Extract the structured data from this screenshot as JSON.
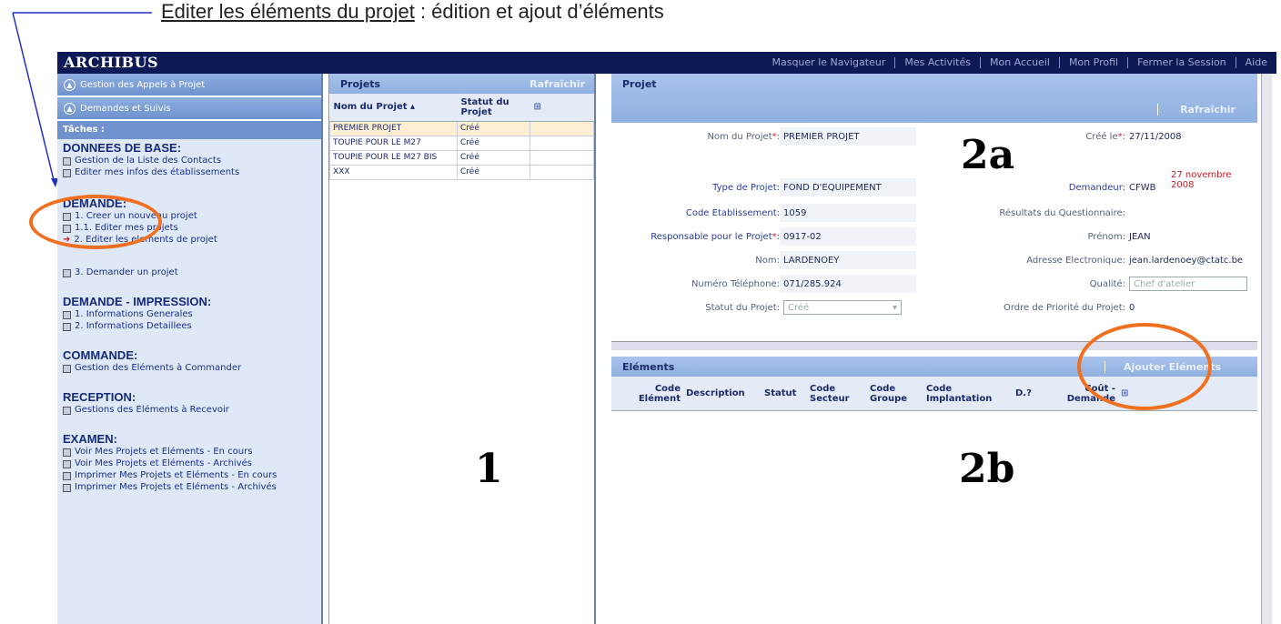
{
  "caption": {
    "link": "Editer les éléments du projet",
    "rest": " : édition et ajout d’éléments"
  },
  "app": {
    "logo": "ARCHIBUS"
  },
  "topnav": [
    "Masquer le Navigateur",
    "Mes Activités",
    "Mon Accueil",
    "Mon Profil",
    "Fermer la Session",
    "Aide"
  ],
  "nav": {
    "acc1": "Gestion des Appels à Projet",
    "acc2": "Demandes et Suivis",
    "taches": "Tâches :",
    "sections": [
      {
        "title": "DONNEES DE BASE:",
        "items": [
          "Gestion de la Liste des Contacts",
          "Editer mes infos des établissements"
        ]
      },
      {
        "title": "DEMANDE:",
        "items": [
          "1. Creer un nouveau projet",
          "1.1. Editer mes projets",
          "2. Editer les elements de projet",
          "3. Demander un projet"
        ]
      },
      {
        "title": "DEMANDE - IMPRESSION:",
        "items": [
          "1. Informations Generales",
          "2. Informations Detaillees"
        ]
      },
      {
        "title": "COMMANDE:",
        "items": [
          "Gestion des Eléments à Commander"
        ]
      },
      {
        "title": "RECEPTION:",
        "items": [
          "Gestions des Eléments à Recevoir"
        ]
      },
      {
        "title": "EXAMEN:",
        "items": [
          "Voir Mes Projets et Eléments - En cours",
          "Voir Mes Projets et Eléments - Archivés",
          "Imprimer Mes Projets et Eléments - En cours",
          "Imprimer Mes Projets et Eléments - Archivés"
        ]
      }
    ]
  },
  "projets": {
    "title": "Projets",
    "refresh": "Rafraîchir",
    "col1": "Nom du Projet",
    "col2": "Statut du Projet",
    "rows": [
      {
        "name": "PREMIER PROJET",
        "status": "Créé"
      },
      {
        "name": "TOUPIE POUR LE M27",
        "status": "Créé"
      },
      {
        "name": "TOUPIE POUR LE M27 BIS",
        "status": "Créé"
      },
      {
        "name": "XXX",
        "status": "Créé"
      }
    ]
  },
  "projet": {
    "title": "Projet",
    "refresh": "Rafraîchir",
    "fields": {
      "nom_label": "Nom du Projet",
      "nom": "PREMIER PROJET",
      "cree_label": "Créé le",
      "cree": "27/11/2008",
      "cree_long": "27 novembre 2008",
      "type_label": "Type de Projet:",
      "type": "FOND D'EQUIPEMENT",
      "demandeur_label": "Demandeur:",
      "demandeur": "CFWB",
      "code_label": "Code Etablissement:",
      "code": "1059",
      "resultats_label": "Résultats du Questionnaire:",
      "resp_label": "Responsable pour le Projet",
      "resp": "0917-02",
      "prenom_label": "Prénom:",
      "prenom": "JEAN",
      "nomp_label": "Nom:",
      "nomp": "LARDENOEY",
      "email_label": "Adresse Electronique:",
      "email": "jean.lardenoey@ctatc.be",
      "tel_label": "Numéro Téléphone:",
      "tel": "071/285.924",
      "qualite_label": "Qualité:",
      "qualite": "Chef d'atelier",
      "statut_label": "Statut du Projet:",
      "statut": "Créé",
      "ordre_label": "Ordre de Priorité du Projet:",
      "ordre": "0"
    }
  },
  "elements": {
    "title": "Eléments",
    "add": "Ajouter Eléments",
    "cols": [
      "Code Elément",
      "Description",
      "Statut",
      "Code Secteur",
      "Code Groupe",
      "Code Implantation",
      "D.?",
      "Coût - Demande"
    ]
  },
  "markers": {
    "one": "1",
    "two_a": "2a",
    "two_b": "2b"
  },
  "colors": {
    "topbar": "#0d1a55",
    "panel": "#8fb0e0",
    "nav_bg": "#dfe8f6",
    "highlight": "#f07020"
  }
}
